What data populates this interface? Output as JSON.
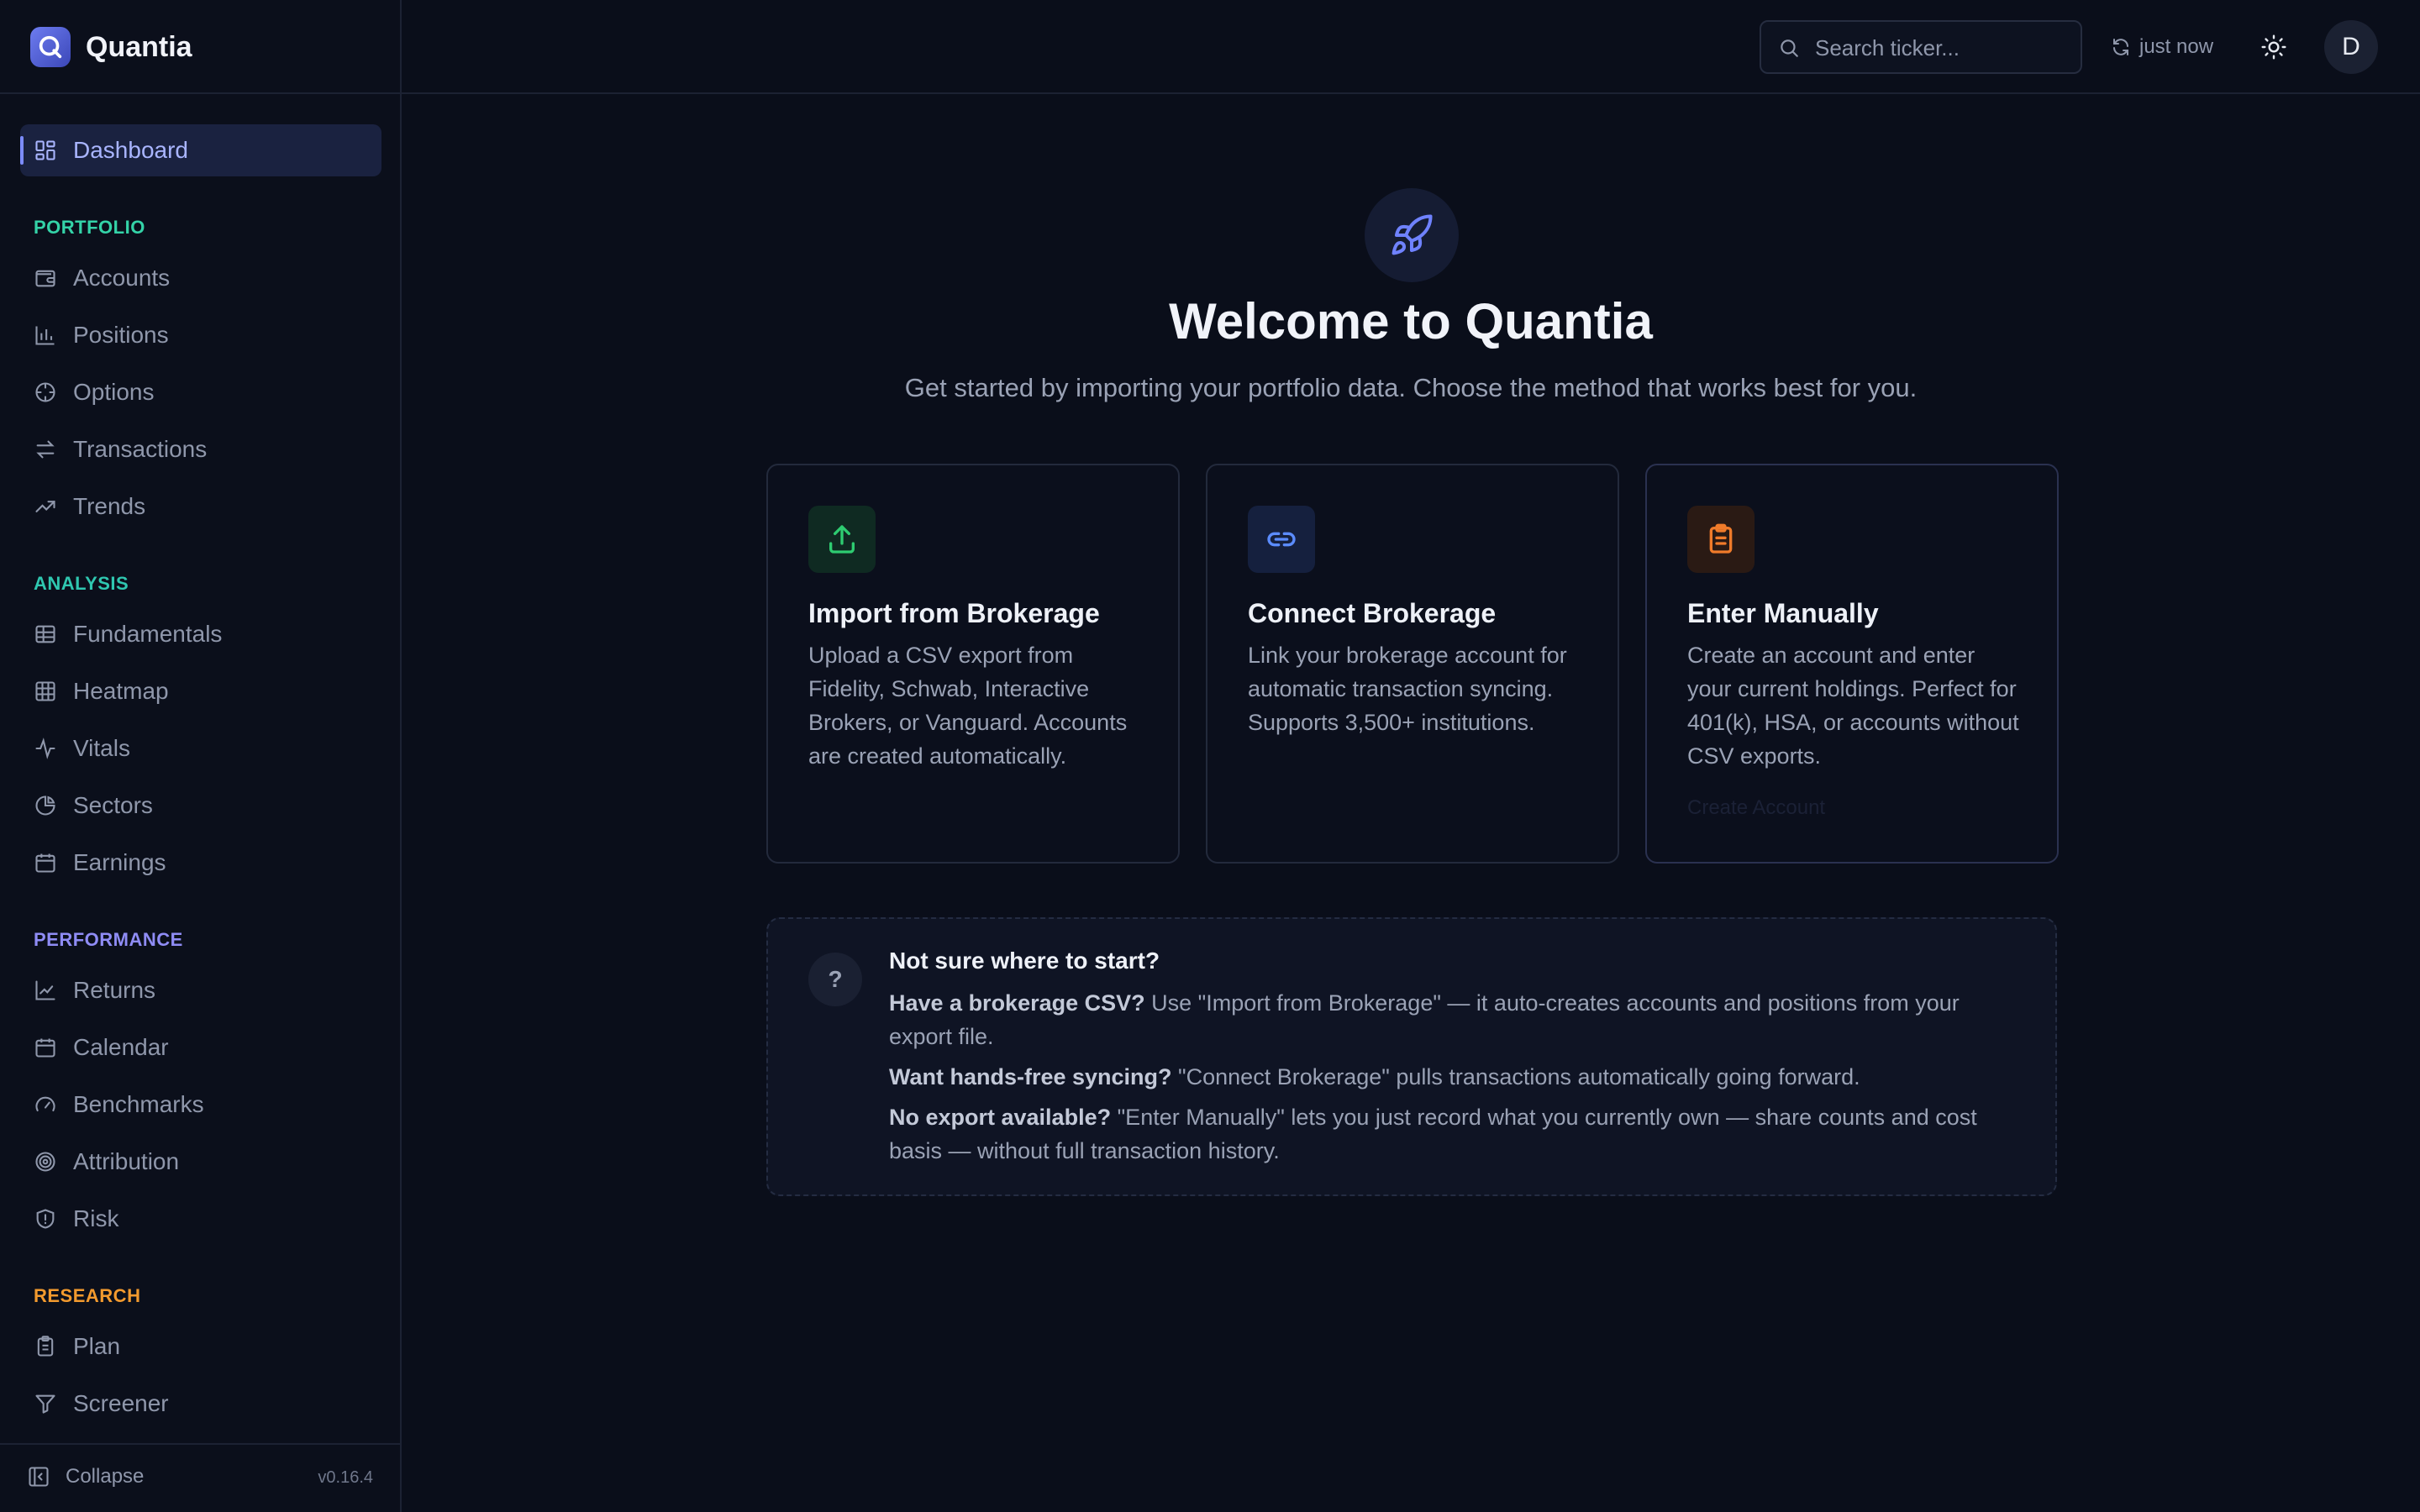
{
  "app": {
    "name": "Quantia",
    "version": "v0.16.4"
  },
  "colors": {
    "accent": "#7c8cff",
    "portfolio_label": "#34d3a8",
    "analysis_label": "#2fc7b0",
    "performance_label": "#8f8cf5",
    "research_label": "#f29a2e",
    "import_icon": "#2ecc71",
    "connect_icon": "#5b8cff",
    "manual_icon": "#f07b2a"
  },
  "sidebar": {
    "dashboard": "Dashboard",
    "sections": [
      {
        "label": "PORTFOLIO",
        "items": [
          "Accounts",
          "Positions",
          "Options",
          "Transactions",
          "Trends"
        ]
      },
      {
        "label": "ANALYSIS",
        "items": [
          "Fundamentals",
          "Heatmap",
          "Vitals",
          "Sectors",
          "Earnings"
        ]
      },
      {
        "label": "PERFORMANCE",
        "items": [
          "Returns",
          "Calendar",
          "Benchmarks",
          "Attribution",
          "Risk"
        ]
      },
      {
        "label": "RESEARCH",
        "items": [
          "Plan",
          "Screener"
        ]
      }
    ],
    "collapse": "Collapse"
  },
  "topbar": {
    "search_placeholder": "Search ticker...",
    "refresh_status": "just now",
    "avatar_initial": "D"
  },
  "welcome": {
    "title": "Welcome to Quantia",
    "subtitle": "Get started by importing your portfolio data. Choose the method that works best for you."
  },
  "cards": [
    {
      "title": "Import from Brokerage",
      "description": "Upload a CSV export from Fidelity, Schwab, Interactive Brokers, or Vanguard. Accounts are created automatically.",
      "icon": "upload-icon"
    },
    {
      "title": "Connect Brokerage",
      "description": "Link your brokerage account for automatic transaction syncing. Supports 3,500+ institutions.",
      "icon": "link-icon"
    },
    {
      "title": "Enter Manually",
      "description": "Create an account and enter your current holdings. Perfect for 401(k), HSA, or accounts without CSV exports.",
      "action": "Create Account",
      "icon": "clipboard-icon"
    }
  ],
  "help": {
    "title": "Not sure where to start?",
    "lines": [
      {
        "bold": "Have a brokerage CSV?",
        "text": " Use \"Import from Brokerage\" — it auto-creates accounts and positions from your export file."
      },
      {
        "bold": "Want hands-free syncing?",
        "text": " \"Connect Brokerage\" pulls transactions automatically going forward."
      },
      {
        "bold": "No export available?",
        "text": " \"Enter Manually\" lets you just record what you currently own — share counts and cost basis — without full transaction history."
      }
    ]
  }
}
